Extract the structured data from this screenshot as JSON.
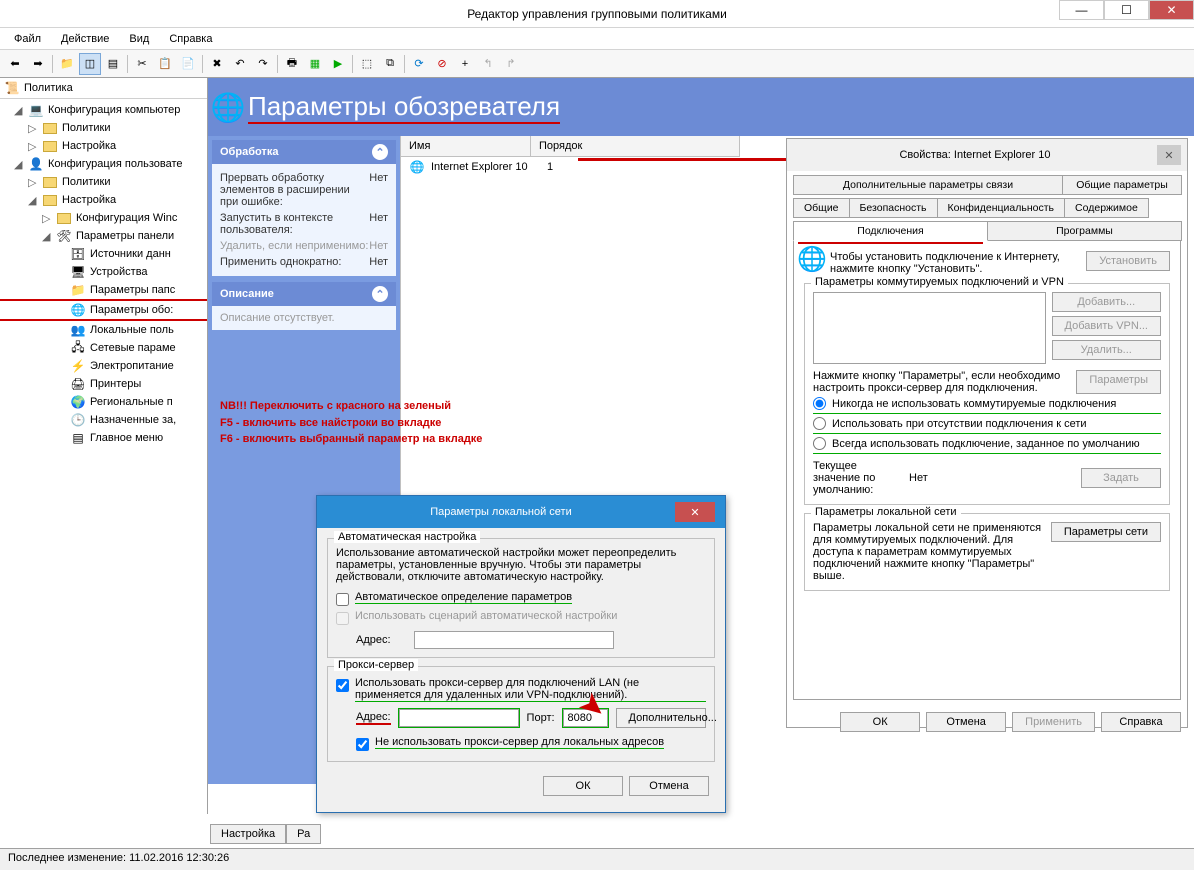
{
  "window": {
    "title": "Редактор управления групповыми политиками"
  },
  "menu": [
    "Файл",
    "Действие",
    "Вид",
    "Справка"
  ],
  "tree": {
    "root": "Политика",
    "items": [
      {
        "indent": 1,
        "expander": "◢",
        "icon": "computer",
        "label": "Конфигурация компьютер"
      },
      {
        "indent": 2,
        "expander": "▷",
        "icon": "folder",
        "label": "Политики"
      },
      {
        "indent": 2,
        "expander": "▷",
        "icon": "folder",
        "label": "Настройка"
      },
      {
        "indent": 1,
        "expander": "◢",
        "icon": "user",
        "label": "Конфигурация пользовате"
      },
      {
        "indent": 2,
        "expander": "▷",
        "icon": "folder",
        "label": "Политики"
      },
      {
        "indent": 2,
        "expander": "◢",
        "icon": "folder",
        "label": "Настройка"
      },
      {
        "indent": 3,
        "expander": "▷",
        "icon": "folder",
        "label": "Конфигурация Winc"
      },
      {
        "indent": 3,
        "expander": "◢",
        "icon": "cpanel",
        "label": "Параметры панели "
      },
      {
        "indent": 4,
        "expander": "",
        "icon": "data",
        "label": "Источники данн"
      },
      {
        "indent": 4,
        "expander": "",
        "icon": "device",
        "label": "Устройства"
      },
      {
        "indent": 4,
        "expander": "",
        "icon": "folder-opt",
        "label": "Параметры папс"
      },
      {
        "indent": 4,
        "expander": "",
        "icon": "ie",
        "label": "Параметры обо:",
        "selected": true
      },
      {
        "indent": 4,
        "expander": "",
        "icon": "users",
        "label": "Локальные поль"
      },
      {
        "indent": 4,
        "expander": "",
        "icon": "network",
        "label": "Сетевые параме"
      },
      {
        "indent": 4,
        "expander": "",
        "icon": "power",
        "label": "Электропитание"
      },
      {
        "indent": 4,
        "expander": "",
        "icon": "printer",
        "label": "Принтеры"
      },
      {
        "indent": 4,
        "expander": "",
        "icon": "regional",
        "label": "Региональные п"
      },
      {
        "indent": 4,
        "expander": "",
        "icon": "sched",
        "label": "Назначенные за,"
      },
      {
        "indent": 4,
        "expander": "",
        "icon": "startmenu",
        "label": "Главное меню"
      }
    ]
  },
  "header": {
    "title": "Параметры обозревателя"
  },
  "sidebar": {
    "processing": {
      "title": "Обработка",
      "rows": [
        {
          "label": "Прервать обработку элементов в расширении при ошибке:",
          "value": "Нет"
        },
        {
          "label": "Запустить в контексте пользователя:",
          "value": "Нет"
        },
        {
          "label": "Удалить, если неприменимо:",
          "value": "Нет",
          "gray": true
        },
        {
          "label": "Применить однократно:",
          "value": "Нет"
        }
      ]
    },
    "description": {
      "title": "Описание",
      "text": "Описание отсутствует."
    }
  },
  "list": {
    "columns": [
      "Имя",
      "Порядок"
    ],
    "rows": [
      {
        "name": "Internet Explorer 10",
        "order": "1"
      }
    ]
  },
  "red_notes": {
    "l1": "NB!!! Переключить с красного на зеленый",
    "l2": "F5 - включить все найстроки во вкладке",
    "l3": "F6  - включить выбранный параметр на вкладке"
  },
  "props": {
    "title": "Свойства: Internet Explorer 10",
    "tabs_top": [
      "Дополнительные параметры связи",
      "Общие параметры"
    ],
    "tabs_mid": [
      "Общие",
      "Безопасность",
      "Конфиденциальность",
      "Содержимое"
    ],
    "tabs_bot": [
      "Подключения",
      "Программы"
    ],
    "setup_text": "Чтобы установить подключение к Интернету, нажмите кнопку \"Установить\".",
    "btn_setup": "Установить",
    "dial_group": "Параметры коммутируемых подключений и VPN",
    "btn_add": "Добавить...",
    "btn_add_vpn": "Добавить VPN...",
    "btn_delete": "Удалить...",
    "btn_props": "Параметры",
    "dial_note": "Нажмите кнопку \"Параметры\", если необходимо настроить прокси-сервер для подключения.",
    "radio1": "Никогда не использовать коммутируемые подключения",
    "radio2": "Использовать при отсутствии подключения к сети",
    "radio3": "Всегда использовать подключение, заданное по умолчанию",
    "cur_label": "Текущее значение по умолчанию:",
    "cur_value": "Нет",
    "btn_default": "Задать",
    "lan_group": "Параметры локальной сети",
    "lan_text": "Параметры локальной сети не применяются для коммутируемых подключений. Для доступа к параметрам коммутируемых подключений нажмите кнопку \"Параметры\" выше.",
    "btn_lan": "Параметры сети",
    "btn_ok": "ОК",
    "btn_cancel": "Отмена",
    "btn_apply": "Применить",
    "btn_help": "Справка"
  },
  "lan": {
    "title": "Параметры локальной сети",
    "auto_group": "Автоматическая настройка",
    "auto_text": "Использование автоматической настройки может переопределить параметры, установленные вручную. Чтобы эти параметры действовали, отключите автоматическую настройку.",
    "cb_auto": "Автоматическое определение параметров",
    "cb_script": "Использовать сценарий автоматической настройки",
    "addr_label": "Адрес:",
    "proxy_group": "Прокси-сервер",
    "cb_proxy": "Использовать прокси-сервер для подключений LAN (не применяется для удаленных или VPN-подключений).",
    "port_label": "Порт:",
    "port_value": "8080",
    "btn_advanced": "Дополнительно...",
    "cb_bypass": "Не использовать прокси-сервер для локальных адресов",
    "btn_ok": "ОК",
    "btn_cancel": "Отмена"
  },
  "bottom_tabs": [
    "Настройка",
    "Ра"
  ],
  "status": "Последнее изменение: 11.02.2016 12:30:26"
}
